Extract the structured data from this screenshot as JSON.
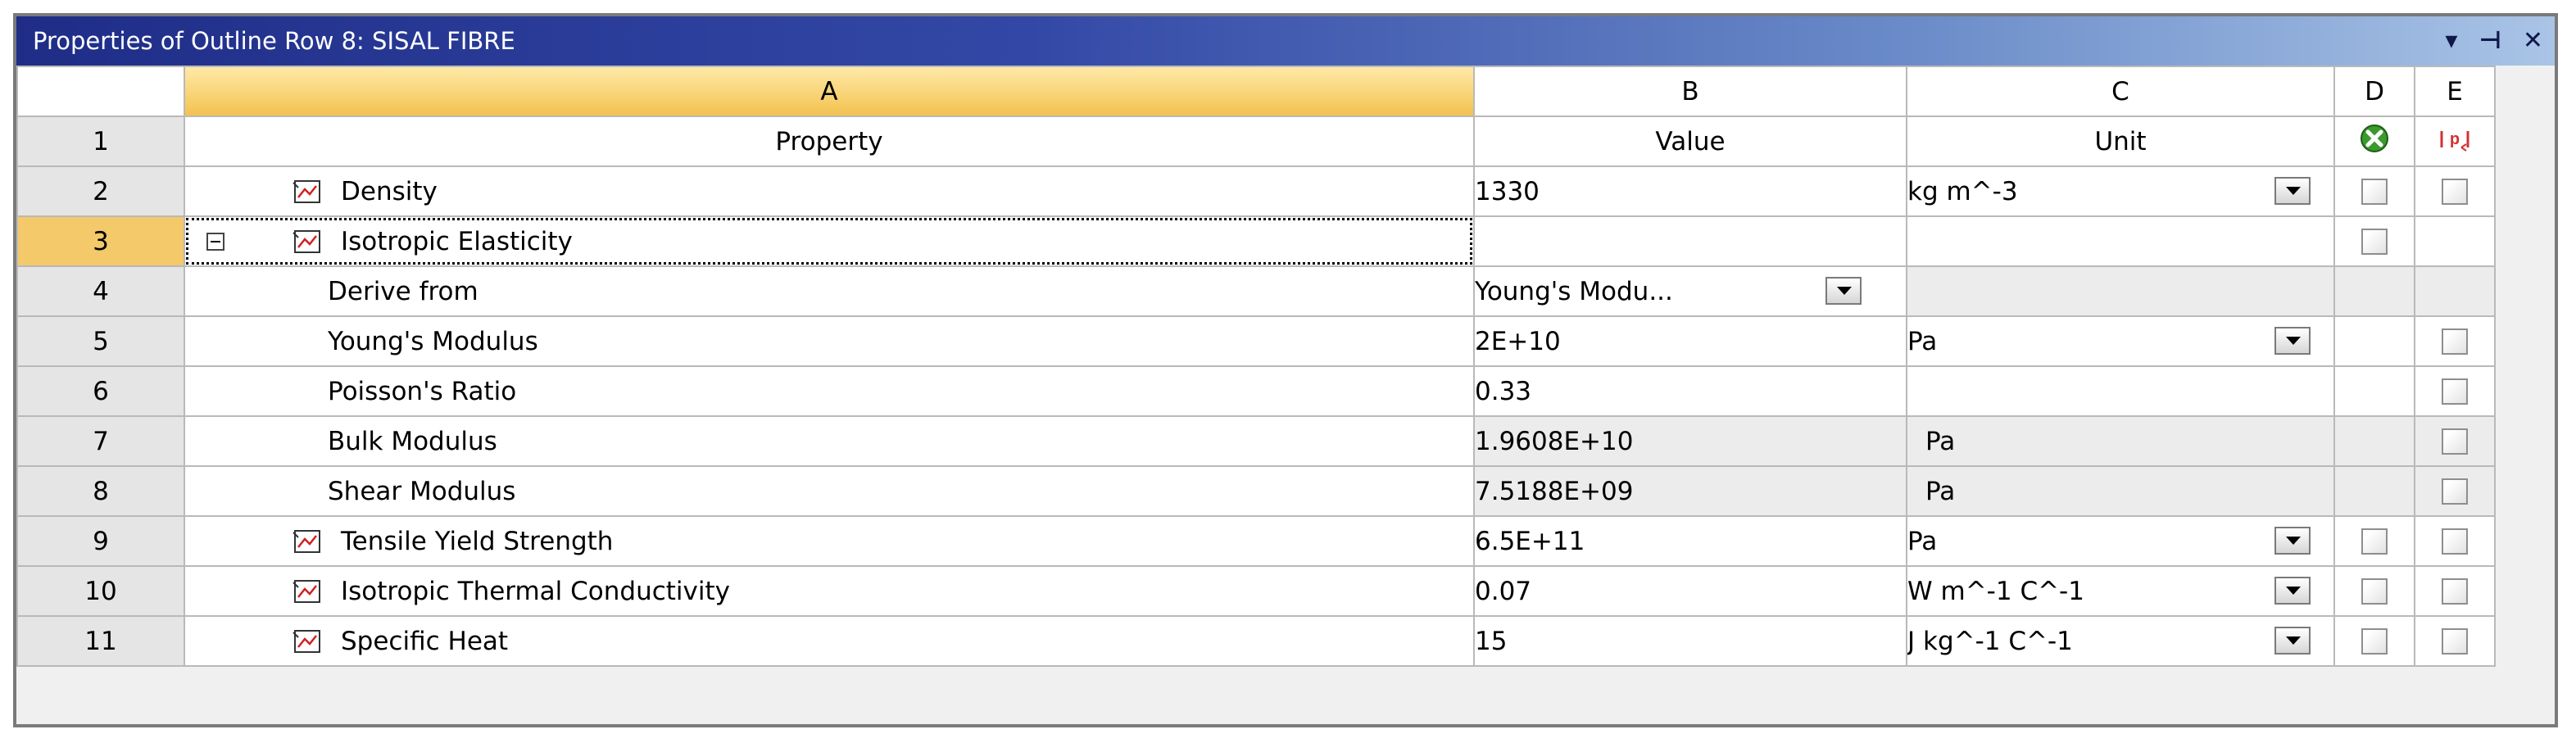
{
  "window": {
    "title": "Properties of Outline Row 8: SISAL FIBRE",
    "buttons": {
      "menu": "▾",
      "pin": "⊣",
      "close": "✕"
    }
  },
  "columns": {
    "row": "",
    "a": "A",
    "b": "B",
    "c": "C",
    "d": "D",
    "e": "E"
  },
  "header_row": {
    "num": "1",
    "property": "Property",
    "value": "Value",
    "unit": "Unit"
  },
  "rows": [
    {
      "num": "2",
      "property": "Density",
      "value": "1330",
      "unit": "kg m^-3"
    },
    {
      "num": "3",
      "property": "Isotropic Elasticity",
      "value": "",
      "unit": ""
    },
    {
      "num": "4",
      "property": "Derive from",
      "value": "Young's Modu...",
      "unit": ""
    },
    {
      "num": "5",
      "property": "Young's Modulus",
      "value": "2E+10",
      "unit": "Pa"
    },
    {
      "num": "6",
      "property": "Poisson's Ratio",
      "value": "0.33",
      "unit": ""
    },
    {
      "num": "7",
      "property": "Bulk Modulus",
      "value": "1.9608E+10",
      "unit": "Pa"
    },
    {
      "num": "8",
      "property": "Shear Modulus",
      "value": "7.5188E+09",
      "unit": "Pa"
    },
    {
      "num": "9",
      "property": "Tensile Yield Strength",
      "value": "6.5E+11",
      "unit": "Pa"
    },
    {
      "num": "10",
      "property": "Isotropic Thermal Conductivity",
      "value": "0.07",
      "unit": "W m^-1 C^-1"
    },
    {
      "num": "11",
      "property": "Specific Heat",
      "value": "15",
      "unit": "J kg^-1 C^-1"
    }
  ],
  "colors": {
    "title_bar_start": "#1f2d87",
    "column_a_header": "#f3c24f",
    "property_header": "#a9c9ee",
    "selected_row": "#f3c96a"
  }
}
